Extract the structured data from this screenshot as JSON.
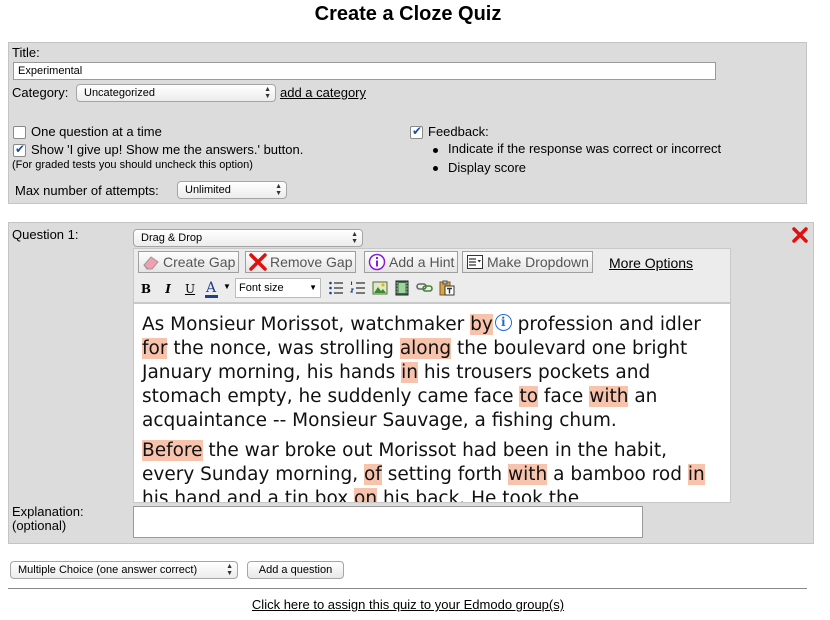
{
  "page": {
    "title": "Create a Cloze Quiz"
  },
  "settings": {
    "title_label": "Title:",
    "title_value": "Experimental",
    "category_label": "Category:",
    "category_value": "Uncategorized",
    "add_category_link": "add a category",
    "one_question_label": "One question at a time",
    "one_question_checked": false,
    "show_give_up_label": "Show 'I give up! Show me the answers.' button.",
    "show_give_up_checked": true,
    "graded_note": "(For graded tests you should uncheck this option)",
    "max_attempts_label": "Max number of attempts:",
    "max_attempts_value": "Unlimited",
    "feedback_label": "Feedback:",
    "feedback_checked": true,
    "feedback_items": [
      "Indicate if the response was correct or incorrect",
      "Display score"
    ]
  },
  "question": {
    "label": "Question 1:",
    "type_value": "Drag & Drop",
    "toolbar": {
      "create_gap": "Create Gap",
      "remove_gap": "Remove Gap",
      "add_hint": "Add a Hint",
      "make_dropdown": "Make Dropdown",
      "more_options": "More Options"
    },
    "format": {
      "bold": "B",
      "italic": "I",
      "underline": "U",
      "font_color": "A",
      "font_size": "Font size"
    },
    "passage": [
      [
        {
          "t": "As Monsieur Morissot, watchmaker "
        },
        {
          "t": "by",
          "gap": true
        },
        {
          "t": "",
          "info": true
        },
        {
          "t": " profession and idler "
        },
        {
          "t": "for",
          "gap": true
        },
        {
          "t": " the nonce, was strolling "
        },
        {
          "t": "along",
          "gap": true
        },
        {
          "t": " the boulevard one bright January morning, his hands "
        },
        {
          "t": "in",
          "gap": true
        },
        {
          "t": " his trousers pockets and stomach empty, he suddenly came face "
        },
        {
          "t": "to",
          "gap": true
        },
        {
          "t": " face "
        },
        {
          "t": "with",
          "gap": true
        },
        {
          "t": " an acquaintance -- Monsieur Sauvage, a fishing chum."
        }
      ],
      [
        {
          "t": "Before",
          "gap": true
        },
        {
          "t": " the war broke out Morissot had been in the habit, every Sunday morning, "
        },
        {
          "t": "of",
          "gap": true
        },
        {
          "t": " setting forth "
        },
        {
          "t": "with",
          "gap": true
        },
        {
          "t": " a bamboo rod "
        },
        {
          "t": "in",
          "gap": true
        },
        {
          "t": " his hand and a tin box "
        },
        {
          "t": "on",
          "gap": true
        },
        {
          "t": " his back. He took the"
        }
      ]
    ],
    "explanation_label": "Explanation:",
    "explanation_optional": "(optional)",
    "explanation_value": ""
  },
  "footer": {
    "question_type_value": "Multiple Choice (one answer correct)",
    "add_question_button": "Add a question",
    "assign_link": "Click here to assign this quiz to your Edmodo group(s)"
  },
  "colors": {
    "panel_bg": "#dcdcdc",
    "gap_highlight": "#f7c3ad",
    "delete_red": "#e01010",
    "info_blue": "#1f6fd1"
  }
}
